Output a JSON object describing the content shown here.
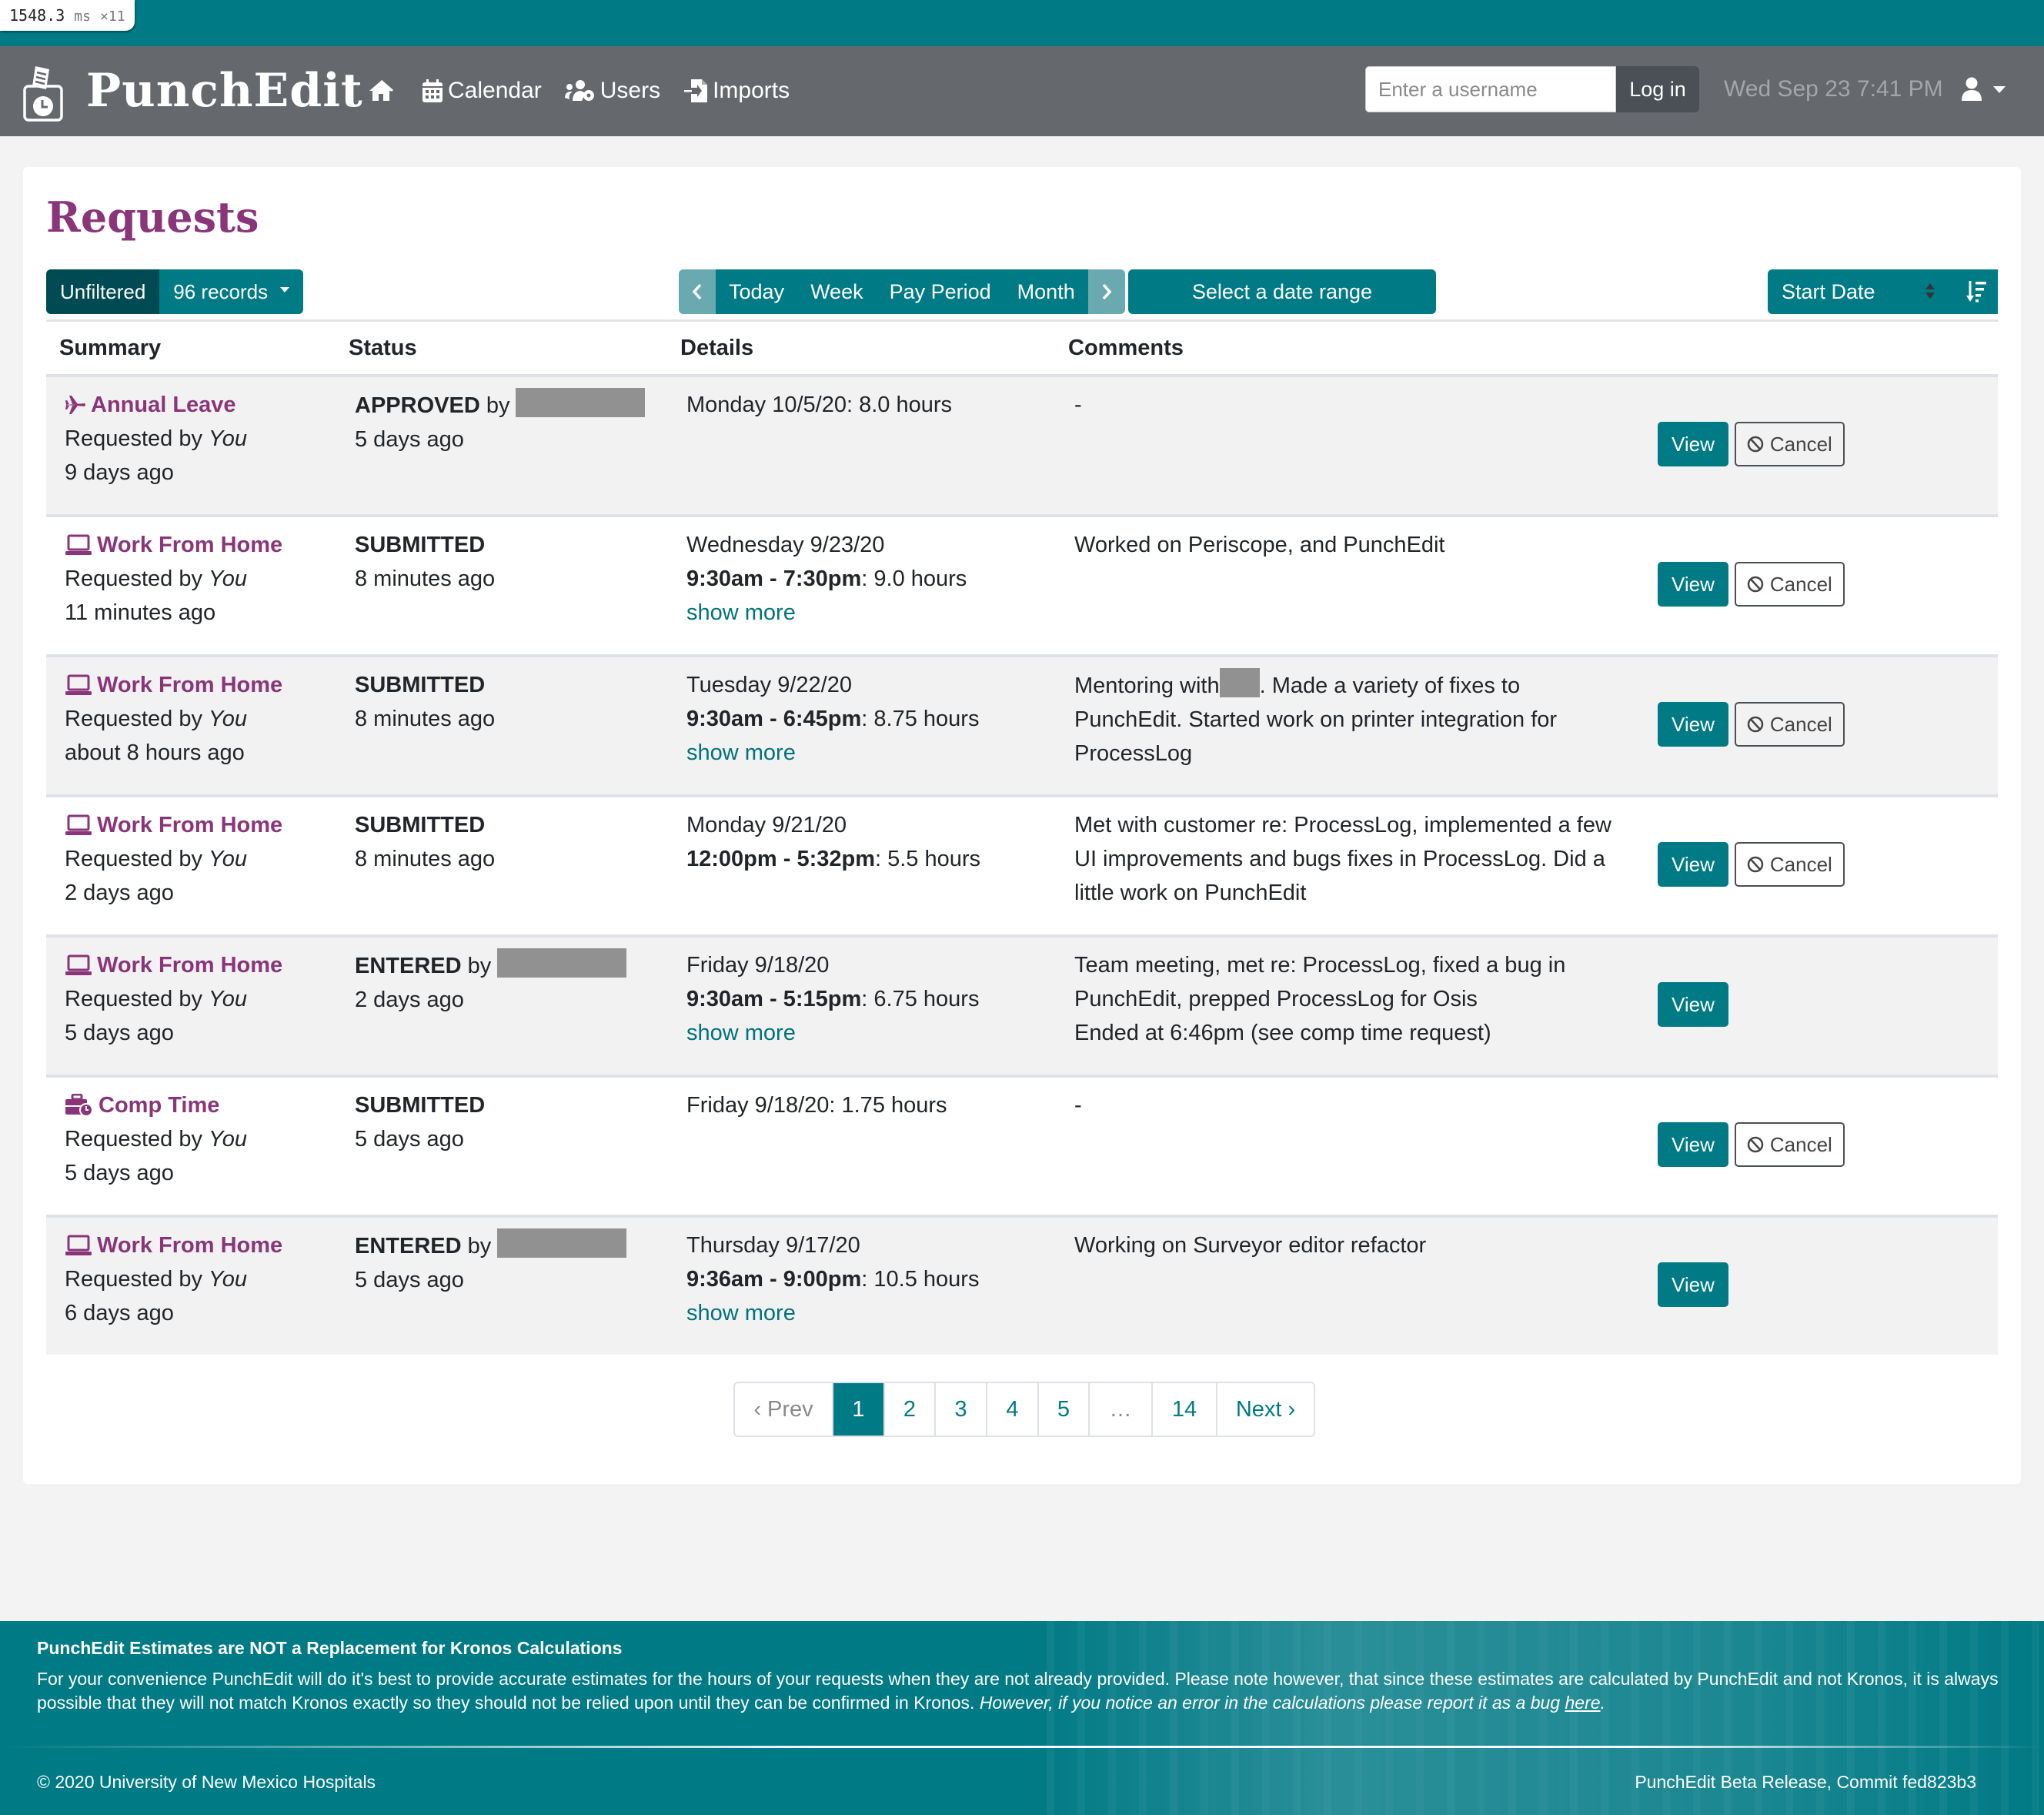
{
  "perf_overlay": {
    "value": "1548.3",
    "unit": "ms",
    "count": "×11"
  },
  "brand": {
    "name": "PunchEdit"
  },
  "nav": {
    "home_icon": "home-icon",
    "items": [
      {
        "label": "Calendar",
        "icon": "calendar-icon"
      },
      {
        "label": "Users",
        "icon": "users-cog-icon"
      },
      {
        "label": "Imports",
        "icon": "file-import-icon"
      }
    ]
  },
  "login": {
    "placeholder": "Enter a username",
    "value": "",
    "button": "Log in"
  },
  "clock": "Wed Sep 23 7:41 PM",
  "page": {
    "title": "Requests"
  },
  "toolbar": {
    "filter_label": "Unfiltered",
    "records_label": "96 records",
    "range_buttons": [
      "Today",
      "Week",
      "Pay Period",
      "Month"
    ],
    "date_range": "Select a date range",
    "sort_field": "Start Date"
  },
  "table": {
    "headers": [
      "Summary",
      "Status",
      "Details",
      "Comments"
    ],
    "rows": [
      {
        "type": "Annual Leave",
        "icon": "plane-icon",
        "requested_by_prefix": "Requested by",
        "requested_by": "You",
        "requested_ago": "9 days ago",
        "status": "APPROVED",
        "status_by": "by",
        "status_redacted": true,
        "status_ago": "5 days ago",
        "detail_date": "Monday 10/5/20: 8.0 hours",
        "detail_time": "",
        "detail_hours": "",
        "show_more": "",
        "comment": "-",
        "actions": {
          "view": "View",
          "cancel": "Cancel"
        }
      },
      {
        "type": "Work From Home",
        "icon": "laptop-icon",
        "requested_by_prefix": "Requested by",
        "requested_by": "You",
        "requested_ago": "11 minutes ago",
        "status": "SUBMITTED",
        "status_by": "",
        "status_redacted": false,
        "status_ago": "8 minutes ago",
        "detail_date": "Wednesday 9/23/20",
        "detail_time": "9:30am - 7:30pm",
        "detail_hours": ": 9.0 hours",
        "show_more": "show more",
        "comment": "Worked on Periscope, and PunchEdit",
        "actions": {
          "view": "View",
          "cancel": "Cancel"
        }
      },
      {
        "type": "Work From Home",
        "icon": "laptop-icon",
        "requested_by_prefix": "Requested by",
        "requested_by": "You",
        "requested_ago": "about 8 hours ago",
        "status": "SUBMITTED",
        "status_by": "",
        "status_redacted": false,
        "status_ago": "8 minutes ago",
        "detail_date": "Tuesday 9/22/20",
        "detail_time": "9:30am - 6:45pm",
        "detail_hours": ": 8.75 hours",
        "show_more": "show more",
        "comment_pre": "Mentoring with",
        "comment_redacted": true,
        "comment": ". Made a variety of fixes to PunchEdit. Started work on printer integration for ProcessLog",
        "actions": {
          "view": "View",
          "cancel": "Cancel"
        }
      },
      {
        "type": "Work From Home",
        "icon": "laptop-icon",
        "requested_by_prefix": "Requested by",
        "requested_by": "You",
        "requested_ago": "2 days ago",
        "status": "SUBMITTED",
        "status_by": "",
        "status_redacted": false,
        "status_ago": "8 minutes ago",
        "detail_date": "Monday 9/21/20",
        "detail_time": "12:00pm - 5:32pm",
        "detail_hours": ": 5.5 hours",
        "show_more": "",
        "comment": "Met with customer re: ProcessLog, implemented a few UI improvements and bugs fixes in ProcessLog. Did a little work on PunchEdit",
        "actions": {
          "view": "View",
          "cancel": "Cancel"
        }
      },
      {
        "type": "Work From Home",
        "icon": "laptop-icon",
        "requested_by_prefix": "Requested by",
        "requested_by": "You",
        "requested_ago": "5 days ago",
        "status": "ENTERED",
        "status_by": "by",
        "status_redacted": true,
        "status_ago": "2 days ago",
        "detail_date": "Friday 9/18/20",
        "detail_time": "9:30am - 5:15pm",
        "detail_hours": ": 6.75 hours",
        "show_more": "show more",
        "comment": "Team meeting, met re: ProcessLog, fixed a bug in PunchEdit, prepped ProcessLog for Osis\nEnded at 6:46pm (see comp time request)",
        "actions": {
          "view": "View",
          "cancel": ""
        }
      },
      {
        "type": "Comp Time",
        "icon": "briefcase-clock-icon",
        "requested_by_prefix": "Requested by",
        "requested_by": "You",
        "requested_ago": "5 days ago",
        "status": "SUBMITTED",
        "status_by": "",
        "status_redacted": false,
        "status_ago": "5 days ago",
        "detail_date": "Friday 9/18/20: 1.75 hours",
        "detail_time": "",
        "detail_hours": "",
        "show_more": "",
        "comment": "-",
        "actions": {
          "view": "View",
          "cancel": "Cancel"
        }
      },
      {
        "type": "Work From Home",
        "icon": "laptop-icon",
        "requested_by_prefix": "Requested by",
        "requested_by": "You",
        "requested_ago": "6 days ago",
        "status": "ENTERED",
        "status_by": "by",
        "status_redacted": true,
        "status_ago": "5 days ago",
        "detail_date": "Thursday 9/17/20",
        "detail_time": "9:36am - 9:00pm",
        "detail_hours": ": 10.5 hours",
        "show_more": "show more",
        "comment": "Working on Surveyor editor refactor",
        "actions": {
          "view": "View",
          "cancel": ""
        }
      }
    ]
  },
  "pagination": {
    "prev": "‹ Prev",
    "pages": [
      "1",
      "2",
      "3",
      "4",
      "5",
      "…",
      "14"
    ],
    "current": "1",
    "next": "Next ›"
  },
  "footer": {
    "title": "PunchEdit Estimates are NOT a Replacement for Kronos Calculations",
    "text": "For your convenience PunchEdit will do it's best to provide accurate estimates for the hours of your requests when they are not already provided. Please note however, that since these estimates are calculated by PunchEdit and not Kronos, it is always possible that they will not match Kronos exactly so they should not be relied upon until they can be confirmed in Kronos.",
    "italic_text": "However, if you notice an error in the calculations please report it as a bug",
    "link_text": "here",
    "copyright": "© 2020 University of New Mexico Hospitals",
    "commit": "PunchEdit Beta Release, Commit fed823b3"
  },
  "colors": {
    "brand_teal": "#007a85",
    "dark_teal": "#004b53",
    "navbar_gray": "#65686d",
    "title_purple": "#8a357a",
    "row_stripe": "#f2f2f2",
    "redacted": "#919191"
  }
}
